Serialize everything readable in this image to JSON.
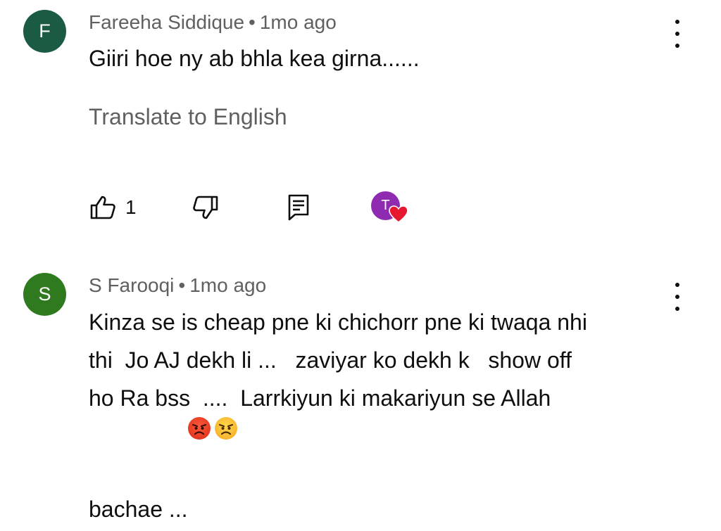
{
  "colors": {
    "avatar_f": "#1c5b43",
    "avatar_s": "#2f7a1e",
    "heart_avatar": "#8e2bb0",
    "heart": "#e5182f",
    "meta_text": "#606060"
  },
  "comments": [
    {
      "avatar_letter": "F",
      "author": "Fareeha Siddique",
      "separator": "•",
      "time": "1mo ago",
      "text": "Giiri hoe ny ab bhla kea girna......",
      "translate": "Translate to English",
      "likes": "1",
      "creator_heart_letter": "T",
      "icons": [
        "thumb-up-icon",
        "thumb-down-icon",
        "reply-icon",
        "creator-heart-icon",
        "more-vert-icon"
      ]
    },
    {
      "avatar_letter": "S",
      "author": "S Farooqi",
      "separator": "•",
      "time": "1mo ago",
      "lines": [
        "Kinza se is cheap pne ki chichorr pne ki twaqa nhi",
        "thi  Jo AJ dekh li ...   zaviyar ko dekh k   show off",
        "ho Ra bss  ....  Larrkiyun ki makariyun se Allah",
        "bachae ..."
      ],
      "emojis": [
        "angry-red-face-emoji",
        "angry-face-emoji"
      ],
      "icons": [
        "more-vert-icon"
      ]
    }
  ]
}
